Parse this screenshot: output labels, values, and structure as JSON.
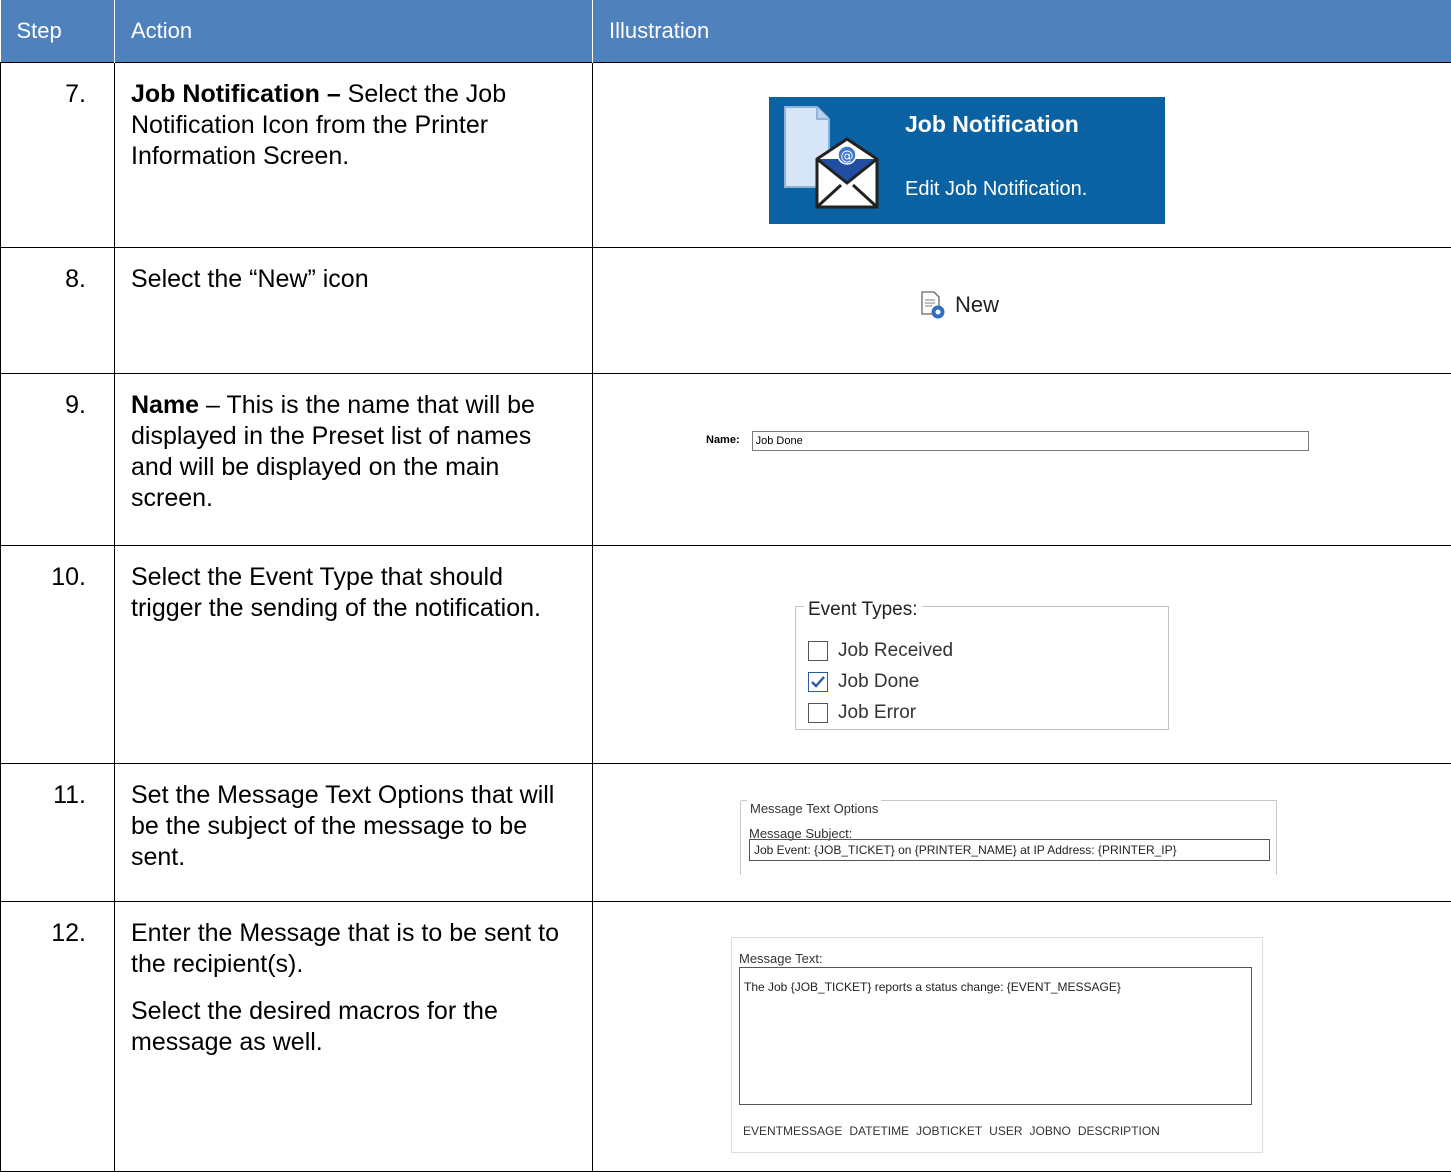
{
  "headers": {
    "step": "Step",
    "action": "Action",
    "illustration": "Illustration"
  },
  "rows": [
    {
      "step": "7.",
      "action_bold": "Job Notification –",
      "action_text": " Select the Job Notification Icon from the Printer Information Screen."
    },
    {
      "step": "8.",
      "action_text": "Select the “New” icon"
    },
    {
      "step": "9.",
      "action_bold": "Name",
      "action_text": " – This is the name that will be displayed in the Preset list of names and will be displayed on the main screen."
    },
    {
      "step": "10.",
      "action_text": "Select the Event Type that should trigger the sending of the notification."
    },
    {
      "step": "11.",
      "action_text": "Set the Message Text Options that will be the subject of the message to be sent."
    },
    {
      "step": "12.",
      "action_text": "Enter the Message that is to be sent to the recipient(s).",
      "action_text2": "Select the desired macros for the message as well."
    }
  ],
  "job_notification": {
    "title": "Job Notification",
    "subtitle": "Edit Job Notification.",
    "icon": "envelope-at-icon",
    "bg_color": "#0a62a3"
  },
  "new_button": {
    "label": "New",
    "icon": "new-document-icon"
  },
  "name_field": {
    "label": "Name:",
    "value": "Job Done"
  },
  "event_types": {
    "legend": "Event Types:",
    "items": [
      {
        "label": "Job Received",
        "checked": false
      },
      {
        "label": "Job Done",
        "checked": true
      },
      {
        "label": "Job Error",
        "checked": false
      }
    ]
  },
  "message_text_options": {
    "legend": "Message Text Options",
    "subject_label": "Message Subject:",
    "subject_value": "Job Event: {JOB_TICKET} on {PRINTER_NAME} at IP Address: {PRINTER_IP}"
  },
  "message_text": {
    "label": "Message Text:",
    "value": "The Job {JOB_TICKET} reports a status change: {EVENT_MESSAGE}",
    "macros": [
      "EVENTMESSAGE",
      "DATETIME",
      "JOBTICKET",
      "USER",
      "JOBNO",
      "DESCRIPTION"
    ]
  },
  "colors": {
    "header_bg": "#4f81bd",
    "header_text": "#ffffff"
  }
}
